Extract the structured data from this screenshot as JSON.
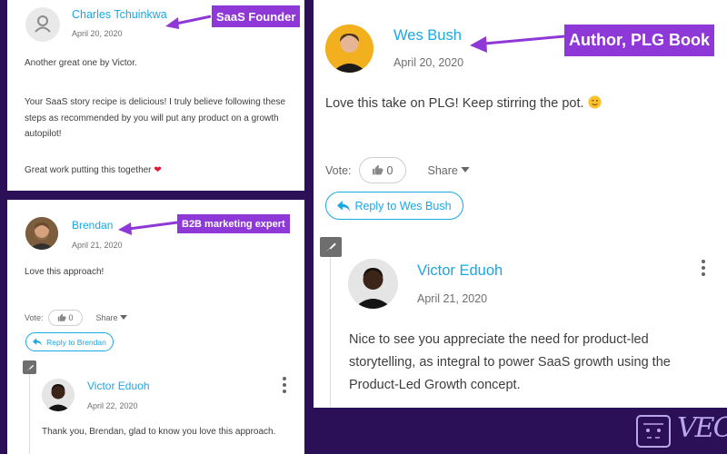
{
  "comment_charles": {
    "author": "Charles Tchuinkwa",
    "date": "April 20, 2020",
    "paragraphs": [
      "Another great one by Victor.",
      "Your SaaS story recipe is delicious! I truly believe following these steps as recommended by you will put any product on a growth autopilot!",
      "Great work putting this together"
    ],
    "emoji": "heart",
    "tag": "SaaS Founder"
  },
  "comment_brendan": {
    "author": "Brendan",
    "date": "April 21, 2020",
    "text": "Love this approach!",
    "vote_label": "Vote:",
    "likes": "0",
    "share_label": "Share",
    "reply_label": "Reply to Brendan",
    "tag": "B2B marketing expert",
    "reply": {
      "author": "Victor Eduoh",
      "date": "April 22, 2020",
      "text": "Thank you, Brendan, glad to know you love this approach."
    }
  },
  "comment_wes": {
    "author": "Wes Bush",
    "date": "April 20, 2020",
    "text": "Love this take on PLG! Keep stirring the pot.",
    "emoji": "wink",
    "vote_label": "Vote:",
    "likes": "0",
    "share_label": "Share",
    "reply_label": "Reply to Wes Bush",
    "tag": "Author, PLG Book",
    "reply": {
      "author": "Victor Eduoh",
      "date": "April 21, 2020",
      "text": "Nice to see you appreciate the need for product-led storytelling, as integral to power SaaS growth using the Product-Led Growth concept."
    }
  },
  "logo": {
    "text": "VEC"
  },
  "colors": {
    "background": "#2b0f57",
    "accent": "#1aa7e6",
    "tag": "#8f38d8",
    "heart": "#e0182d"
  }
}
